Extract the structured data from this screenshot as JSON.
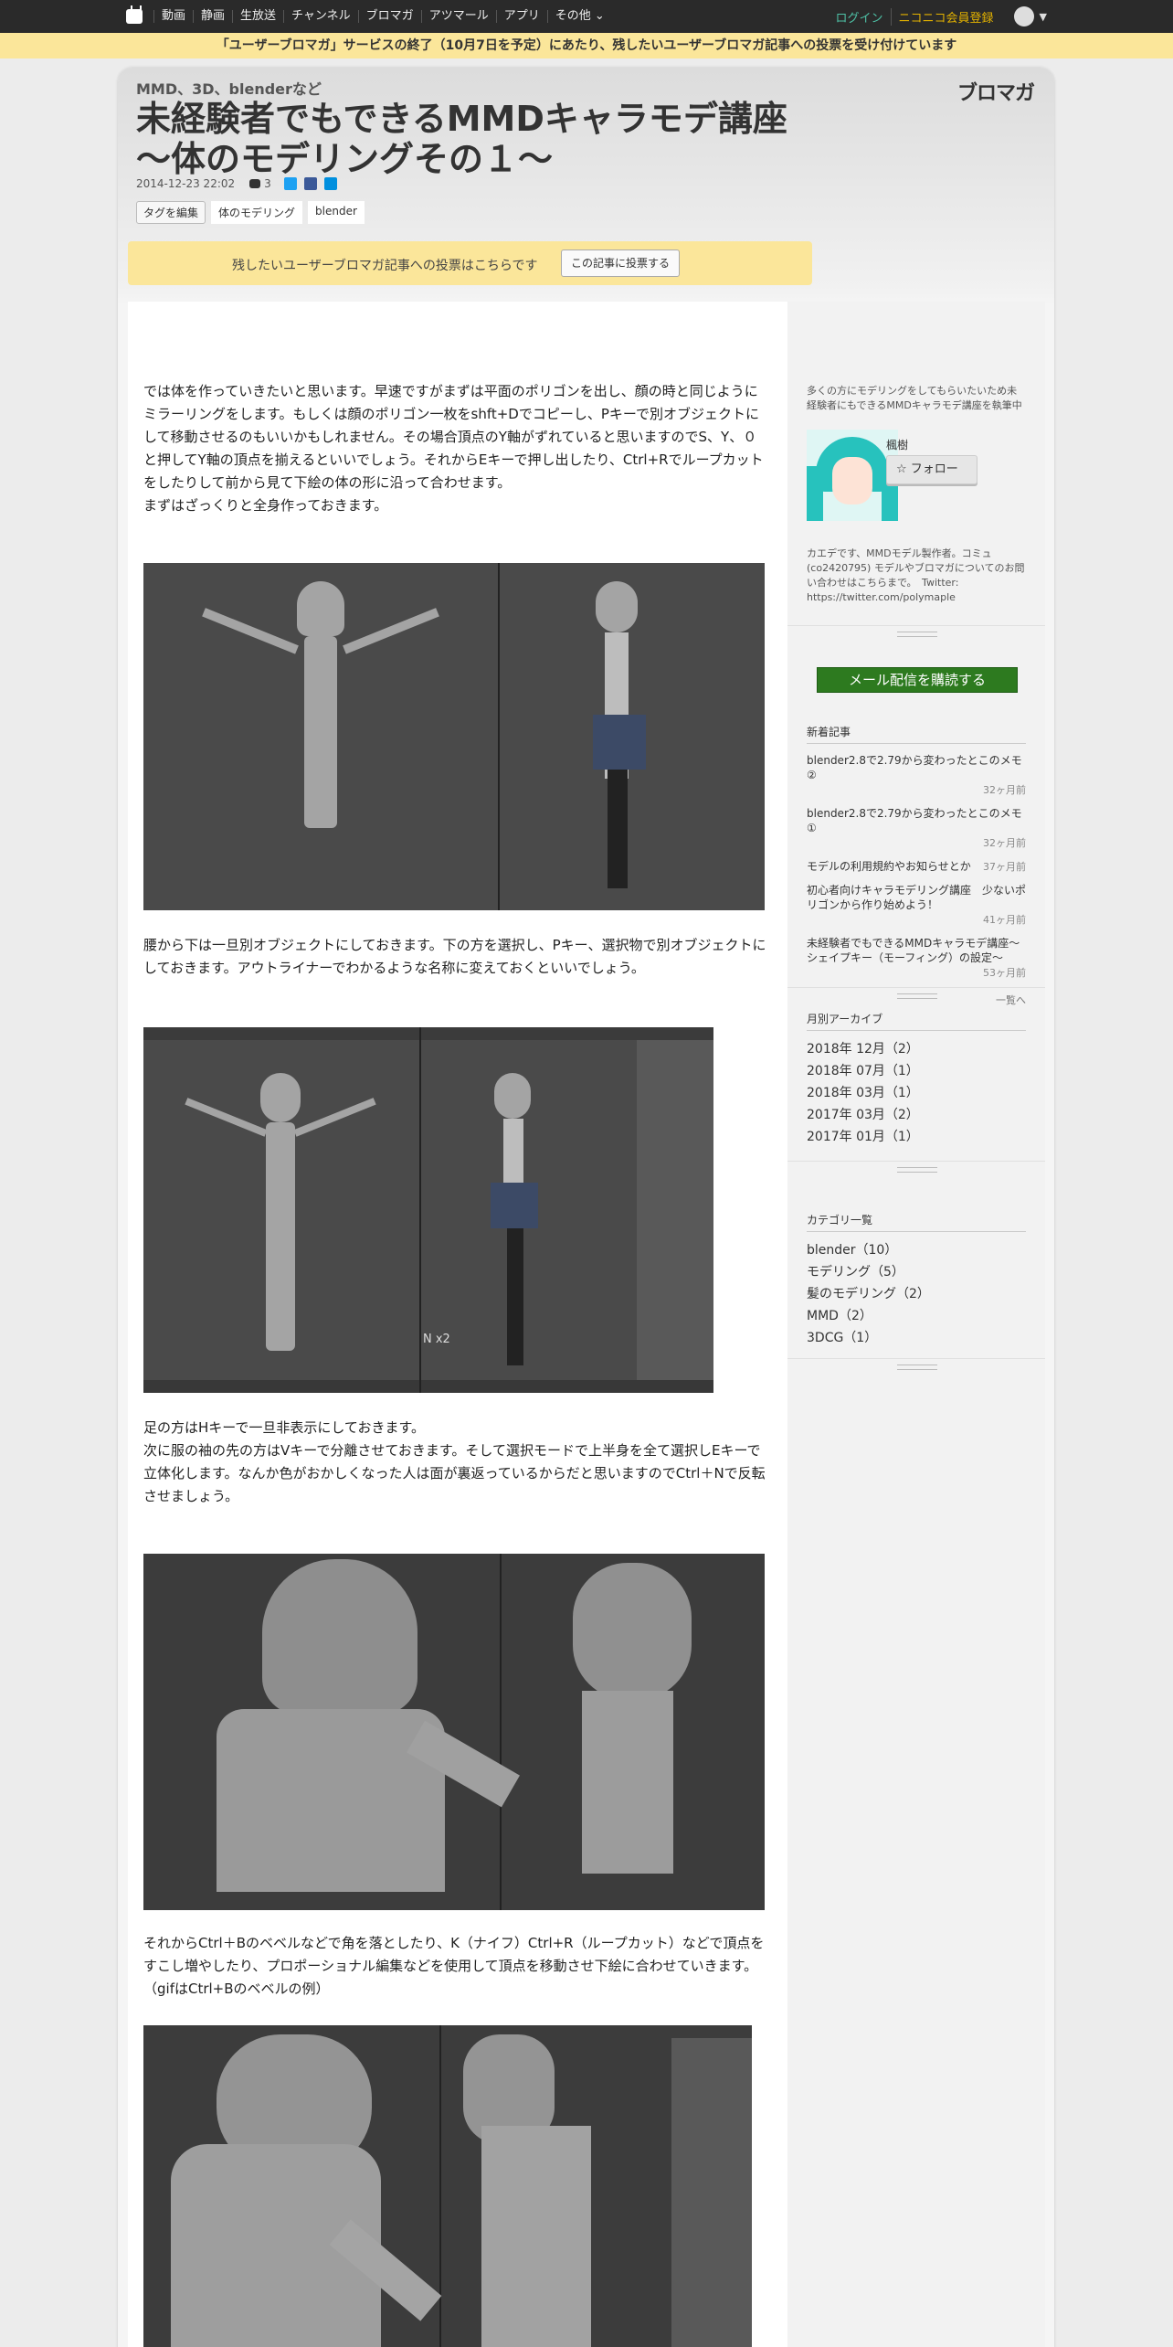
{
  "nav": {
    "items": [
      "動画",
      "静画",
      "生放送",
      "チャンネル",
      "ブロマガ",
      "アツマール",
      "アプリ",
      "その他"
    ],
    "login": "ログイン",
    "signup": "ニコニコ会員登録"
  },
  "notice": "「ユーザーブロマガ」サービスの終了（10月7日を予定）にあたり、残したいユーザーブロマガ記事への投票を受け付けています",
  "brand": "ブロマガ",
  "article": {
    "category": "MMD、3D、blenderなど",
    "title": "未経験者でもできるMMDキャラモデ講座\n～体のモデリングその１～",
    "date": "2014-12-23 22:02",
    "comments": "3",
    "tag_edit": "タグを編集",
    "tags": [
      "体のモデリング",
      "blender"
    ],
    "vote_text": "残したいユーザーブロマガ記事への投票はこちらです",
    "vote_button": "この記事に投票する",
    "p1": "では体を作っていきたいと思います。早速ですがまずは平面のポリゴンを出し、顔の時と同じようにミラーリングをします。もしくは顔のポリゴン一枚をshft+Dでコピーし、Pキーで別オブジェクトにして移動させるのもいいかもしれません。その場合頂点のY軸がずれていると思いますのでS、Y、０と押してY軸の頂点を揃えるといいでしょう。それからEキーで押し出したり、Ctrl+Rでループカットをしたりして前から見て下絵の体の形に沿って合わせます。\nまずはざっくりと全身作っておきます。",
    "p2": "腰から下は一旦別オブジェクトにしておきます。下の方を選択し、Pキー、選択物で別オブジェクトにしておきます。アウトライナーでわかるような名称に変えておくといいでしょう。",
    "p3": "足の方はHキーで一旦非表示にしておきます。\n次に服の袖の先の方はVキーで分離させておきます。そして選択モードで上半身を全て選択しEキーで立体化します。なんか色がおかしくなった人は面が裏返っているからだと思いますのでCtrl＋Nで反転させましょう。",
    "p4": "それからCtrl＋Bのベベルなどで角を落としたり、K（ナイフ）Ctrl+R（ループカット）などで頂点をすこし増やしたり、プロポーショナル編集などを使用して頂点を移動させ下絵に合わせていきます。（gifはCtrl+Bのベベルの例）",
    "shot2_label": "N x2"
  },
  "sidebar": {
    "profile_desc": "多くの方にモデリングをしてもらいたいため未経験者にもできるMMDキャラモデ講座を執筆中",
    "username": "楓樹",
    "follow": "フォロー",
    "bio": "カエデです、MMDモデル製作者。コミュ(co2420795) モデルやブロマガについてのお問い合わせはこちらまで。　Twitter: https://twitter.com/polymaple",
    "subscribe": "メール配信を購読する",
    "recent_title": "新着記事",
    "recent": [
      {
        "t": "blender2.8で2.79から変わったとこのメモ②",
        "a": "32ヶ月前"
      },
      {
        "t": "blender2.8で2.79から変わったとこのメモ①",
        "a": "32ヶ月前"
      },
      {
        "t": "モデルの利用規約やお知らせとか",
        "a": "37ヶ月前"
      },
      {
        "t": "初心者向けキャラモデリング講座　少ないポリゴンから作り始めよう！",
        "a": "41ヶ月前"
      },
      {
        "t": "未経験者でもできるMMDキャラモデ講座～シェイプキー（モーフィング）の設定～",
        "a": "53ヶ月前"
      }
    ],
    "more": "一覧へ",
    "archive_title": "月別アーカイブ",
    "archive": [
      "2018年 12月（2）",
      "2018年 07月（1）",
      "2018年 03月（1）",
      "2017年 03月（2）",
      "2017年 01月（1）"
    ],
    "category_title": "カテゴリ一覧",
    "categories": [
      "blender（10）",
      "モデリング（5）",
      "髪のモデリング（2）",
      "MMD（2）",
      "3DCG（1）"
    ]
  },
  "colors": {
    "nav_bg": "#2a2a2a",
    "notice_bg": "#fbe69a",
    "subscribe_bg": "#2d7a1f",
    "login": "#4ec1a6",
    "signup": "#e2b100"
  }
}
